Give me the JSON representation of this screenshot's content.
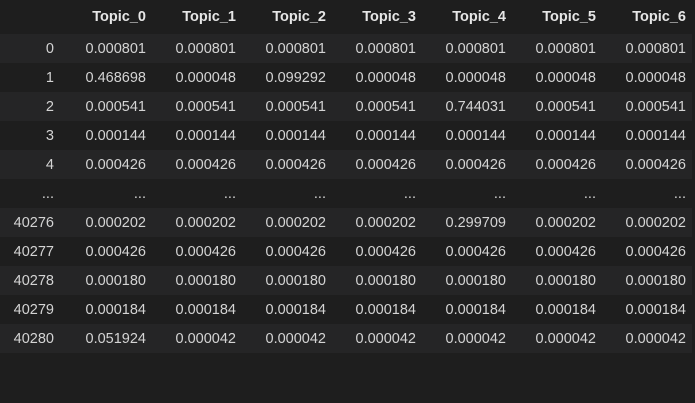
{
  "table": {
    "index_header": "",
    "columns": [
      "Topic_0",
      "Topic_1",
      "Topic_2",
      "Topic_3",
      "Topic_4",
      "Topic_5",
      "Topic_6"
    ],
    "rows": [
      {
        "index": "0",
        "cells": [
          "0.000801",
          "0.000801",
          "0.000801",
          "0.000801",
          "0.000801",
          "0.000801",
          "0.000801"
        ]
      },
      {
        "index": "1",
        "cells": [
          "0.468698",
          "0.000048",
          "0.099292",
          "0.000048",
          "0.000048",
          "0.000048",
          "0.000048"
        ]
      },
      {
        "index": "2",
        "cells": [
          "0.000541",
          "0.000541",
          "0.000541",
          "0.000541",
          "0.744031",
          "0.000541",
          "0.000541"
        ]
      },
      {
        "index": "3",
        "cells": [
          "0.000144",
          "0.000144",
          "0.000144",
          "0.000144",
          "0.000144",
          "0.000144",
          "0.000144"
        ]
      },
      {
        "index": "4",
        "cells": [
          "0.000426",
          "0.000426",
          "0.000426",
          "0.000426",
          "0.000426",
          "0.000426",
          "0.000426"
        ]
      },
      {
        "index": "...",
        "cells": [
          "...",
          "...",
          "...",
          "...",
          "...",
          "...",
          "..."
        ]
      },
      {
        "index": "40276",
        "cells": [
          "0.000202",
          "0.000202",
          "0.000202",
          "0.000202",
          "0.299709",
          "0.000202",
          "0.000202"
        ]
      },
      {
        "index": "40277",
        "cells": [
          "0.000426",
          "0.000426",
          "0.000426",
          "0.000426",
          "0.000426",
          "0.000426",
          "0.000426"
        ]
      },
      {
        "index": "40278",
        "cells": [
          "0.000180",
          "0.000180",
          "0.000180",
          "0.000180",
          "0.000180",
          "0.000180",
          "0.000180"
        ]
      },
      {
        "index": "40279",
        "cells": [
          "0.000184",
          "0.000184",
          "0.000184",
          "0.000184",
          "0.000184",
          "0.000184",
          "0.000184"
        ]
      },
      {
        "index": "40280",
        "cells": [
          "0.051924",
          "0.000042",
          "0.000042",
          "0.000042",
          "0.000042",
          "0.000042",
          "0.000042"
        ]
      }
    ]
  },
  "colors": {
    "background": "#1e1e1e",
    "stripe": "#252526",
    "text": "#d4d4d4"
  }
}
